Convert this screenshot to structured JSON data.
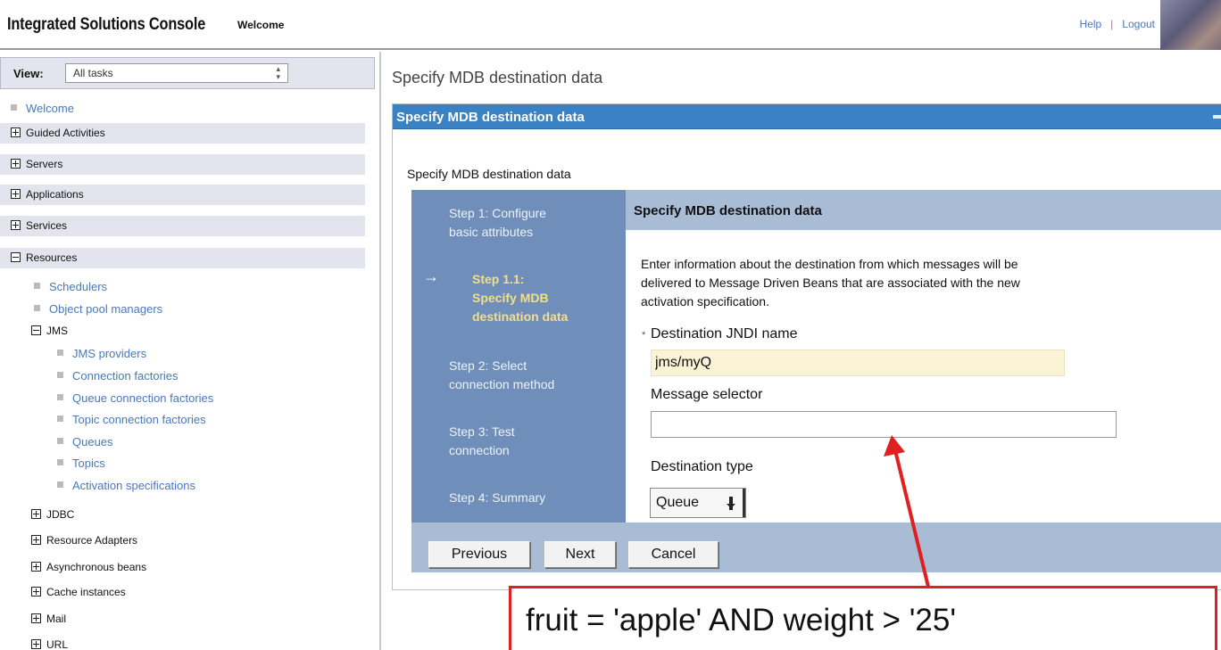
{
  "banner": {
    "title": "Integrated Solutions Console",
    "subtitle": "Welcome",
    "help": "Help",
    "separator": "|",
    "logout": "Logout"
  },
  "nav": {
    "view_label": "View:",
    "view_value": "All tasks",
    "welcome": "Welcome",
    "categories": {
      "guided": "Guided Activities",
      "servers": "Servers",
      "applications": "Applications",
      "services": "Services",
      "resources": "Resources"
    },
    "resources_items": {
      "schedulers": "Schedulers",
      "object_pool": "Object pool managers",
      "jms": "JMS"
    },
    "jms_items": [
      "JMS providers",
      "Connection factories",
      "Queue connection factories",
      "Topic connection factories",
      "Queues",
      "Topics",
      "Activation specifications"
    ],
    "more_resources": [
      "JDBC",
      "Resource Adapters",
      "Asynchronous beans",
      "Cache instances",
      "Mail",
      "URL"
    ]
  },
  "main": {
    "page_title": "Specify MDB destination data",
    "panel_title": "Specify MDB destination data",
    "sub_heading": "Specify MDB destination data",
    "steps": {
      "step1_line1": "Step 1: Configure",
      "step1_line2": "basic attributes",
      "step11_line1": "Step 1.1:",
      "step11_line2": "Specify MDB",
      "step11_line3": "destination data",
      "step2_line1": "Step 2: Select",
      "step2_line2": "connection method",
      "step3_line1": "Step 3: Test",
      "step3_line2": "connection",
      "step4": "Step 4: Summary",
      "arrow": "→"
    },
    "content_title": "Specify MDB destination data",
    "intro_line1": "Enter information about the destination from which messages will be",
    "intro_line2": "delivered to Message Driven Beans that are associated with the new",
    "intro_line3": "activation specification.",
    "required_marker": "*",
    "jndi_label": "Destination JNDI name",
    "jndi_value": "jms/myQ",
    "selector_label": "Message selector",
    "selector_value": "",
    "type_label": "Destination type",
    "type_value": "Queue",
    "buttons": {
      "previous": "Previous",
      "next": "Next",
      "cancel": "Cancel"
    }
  },
  "annotation": {
    "text": "fruit = 'apple' AND weight > '25'",
    "color": "#e02020"
  },
  "colors": {
    "panel_header": "#3b82c4",
    "steps_bg": "#6f8fba",
    "current_step": "#f4de8a",
    "link": "#4a78b8"
  }
}
